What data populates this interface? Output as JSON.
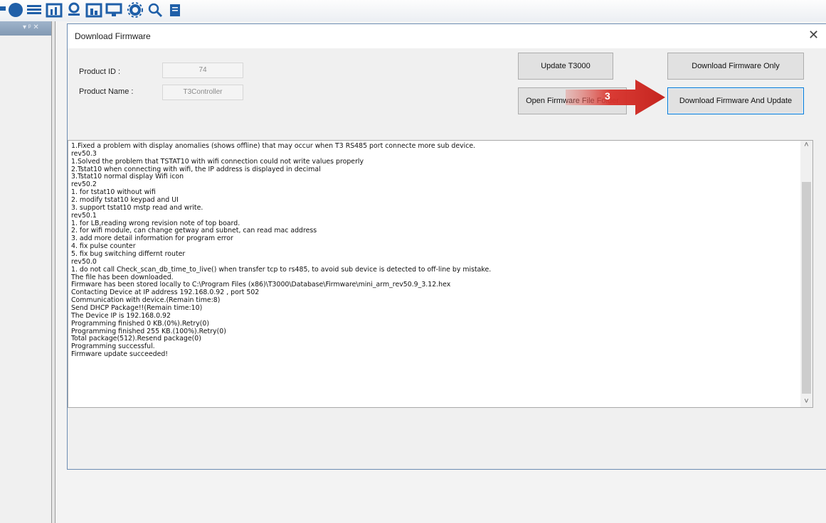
{
  "dialog": {
    "title": "Download Firmware",
    "close_glyph": "✕"
  },
  "fields": {
    "product_id_label": "Product ID :",
    "product_id_value": "74",
    "product_name_label": "Product Name :",
    "product_name_value": "T3Controller"
  },
  "buttons": {
    "update_t3000": "Update T3000",
    "download_firmware_only": "Download Firmware Only",
    "open_firmware_file_folder": "Open Firmware File Folder",
    "download_firmware_and_update": "Download Firmware And Update"
  },
  "annotation": {
    "step_number": "3",
    "arrow_color": "#d9322b"
  },
  "log": [
    "1.Fixed a problem with display anomalies (shows offline) that may occur when T3 RS485 port connecte more sub device.",
    "rev50.3",
    "1.Solved the problem that TSTAT10 with wifi connection could not write values properly",
    "2.Tstat10 when connecting with wifi, the IP address is displayed in decimal",
    "3.Tstat10 normal display Wifi icon",
    "rev50.2",
    "1. for tstat10 without wifi",
    "2. modify tstat10 keypad and UI",
    "3. support tstat10 mstp read and write.",
    "rev50.1",
    "1. for LB,reading wrong revision note of top board.",
    "2. for wifi module, can change getway and subnet, can read mac address",
    "3. add more detail information for program error",
    "4. fix pulse counter",
    "5. fix bug switching differnt router",
    "rev50.0",
    "1. do not call Check_scan_db_time_to_live() when transfer tcp to rs485, to avoid sub device is detected to off-line by mistake.",
    "The file has been downloaded.",
    "Firmware has been stored locally to  C:\\Program Files (x86)\\T3000\\Database\\Firmware\\mini_arm_rev50.9_3.12.hex",
    "Contacting Device at IP address 192.168.0.92 , port 502",
    "Communication with device.(Remain time:8)",
    "Send DHCP Package!!(Remain time:10)",
    "The Device IP is 192.168.0.92",
    "Programming finished 0 KB.(0%).Retry(0)",
    "Programming finished 255 KB.(100%).Retry(0)",
    "Total package(512).Resend package(0)",
    "Programming successful.",
    "Firmware update succeeded!"
  ],
  "scrollbar": {
    "up_glyph": "˄",
    "down_glyph": "˅"
  },
  "toolbar_icons": [
    "partial-icon",
    "globe-icon",
    "list-icon",
    "chart-icon",
    "network-icon",
    "chart-icon",
    "monitor-icon",
    "gear-icon",
    "search-icon",
    "document-icon"
  ],
  "left_pane": {
    "pin_glyph": "▾ ᵖ ✕"
  },
  "colors": {
    "accent_blue": "#0078d7",
    "dialog_border": "#6d8db3",
    "toolbar_icon_blue": "#1f5fa8"
  }
}
